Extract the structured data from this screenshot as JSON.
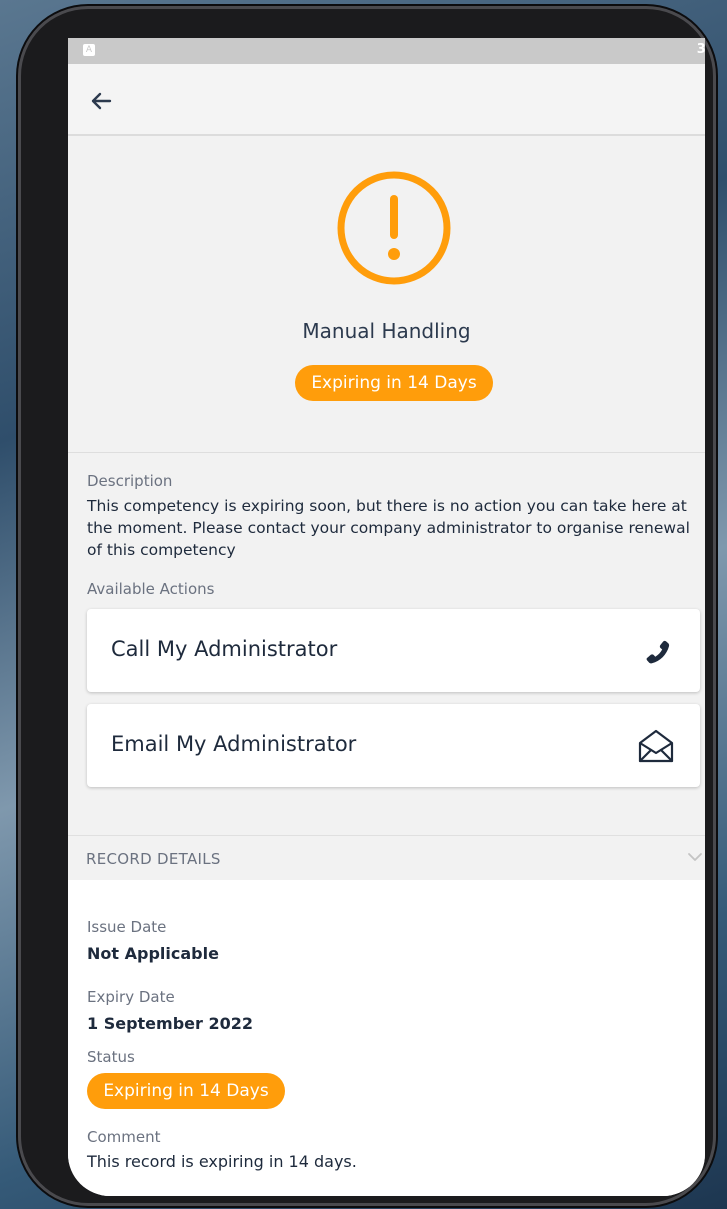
{
  "status_bar": {
    "time": "3:"
  },
  "hero": {
    "icon": "warning-circle-icon",
    "title": "Manual Handling",
    "badge": "Expiring in 14 Days"
  },
  "description": {
    "label": "Description",
    "text": "This competency is expiring soon, but there is no action you can take here at the moment. Please contact your company administrator to organise renewal of this competency"
  },
  "actions": {
    "label": "Available Actions",
    "items": [
      {
        "label": "Call My Administrator",
        "icon": "phone-icon"
      },
      {
        "label": "Email My Administrator",
        "icon": "envelope-open-icon"
      }
    ]
  },
  "record_details": {
    "header": "RECORD DETAILS",
    "issue_date_label": "Issue Date",
    "issue_date": "Not Applicable",
    "expiry_date_label": "Expiry Date",
    "expiry_date": "1 September 2022",
    "status_label": "Status",
    "status": "Expiring in 14 Days",
    "comment_label": "Comment",
    "comment": "This record is expiring in 14 days."
  },
  "colors": {
    "accent": "#ff9d0b",
    "text": "#1e2a3c",
    "muted": "#6b7280"
  }
}
